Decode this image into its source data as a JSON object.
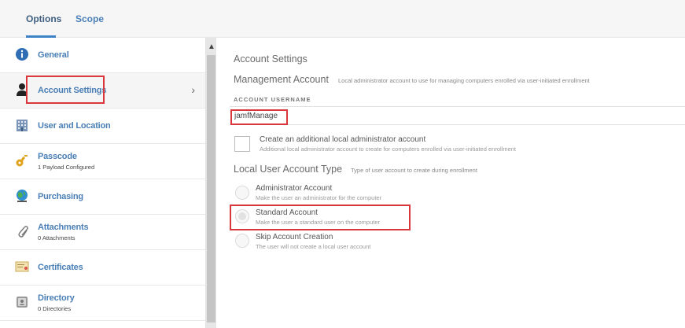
{
  "tabs": [
    {
      "label": "Options"
    },
    {
      "label": "Scope"
    }
  ],
  "sidebar": {
    "items": [
      {
        "label": "General",
        "sub": "",
        "icon": "info-icon"
      },
      {
        "label": "Account Settings",
        "sub": "",
        "icon": "user-icon"
      },
      {
        "label": "User and Location",
        "sub": "",
        "icon": "building-icon"
      },
      {
        "label": "Passcode",
        "sub": "1 Payload Configured",
        "icon": "key-icon"
      },
      {
        "label": "Purchasing",
        "sub": "",
        "icon": "globe-icon"
      },
      {
        "label": "Attachments",
        "sub": "0 Attachments",
        "icon": "paperclip-icon"
      },
      {
        "label": "Certificates",
        "sub": "",
        "icon": "certificate-icon"
      },
      {
        "label": "Directory",
        "sub": "0 Directories",
        "icon": "directory-icon"
      }
    ],
    "selected_chevron": "›",
    "scroll_up": "▲"
  },
  "main": {
    "section_title": "Account Settings",
    "management_title": "Management Account",
    "management_desc": "Local administrator account to use for managing computers enrolled via user-initiated enrollment",
    "username_label": "ACCOUNT USERNAME",
    "username_value": "jamfManage",
    "create_admin_label": "Create an additional local administrator account",
    "create_admin_desc": "Additional local administrator account to create for computers enrolled via user-initiated enrollment",
    "create_admin_checked": false,
    "account_type_title": "Local User Account Type",
    "account_type_desc": "Type of user account to create during enrollment",
    "account_types": [
      {
        "label": "Administrator Account",
        "desc": "Make the user an administrator for the computer",
        "selected": false
      },
      {
        "label": "Standard Account",
        "desc": "Make the user a standard user on the computer",
        "selected": true
      },
      {
        "label": "Skip Account Creation",
        "desc": "The user will not create a local user account",
        "selected": false
      }
    ]
  },
  "colors": {
    "link_blue": "#4a7fb6",
    "tab_underline": "#3c82c8",
    "highlight_red": "#d9373b"
  }
}
